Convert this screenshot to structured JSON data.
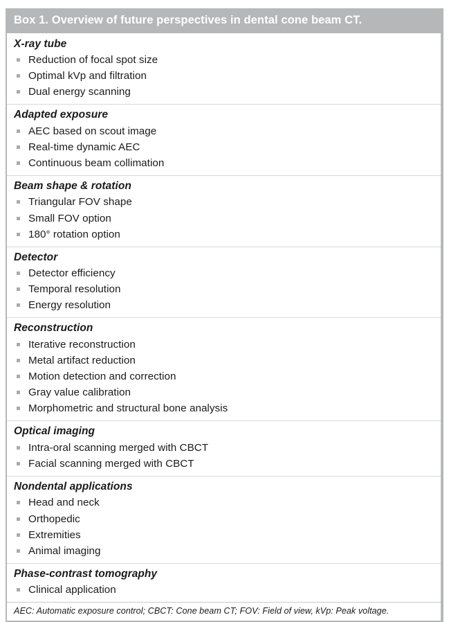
{
  "box": {
    "title": "Box 1. Overview of future perspectives in dental cone beam CT.",
    "header_background": "#b5b7b9",
    "header_text_color": "#ffffff",
    "border_color": "#b5b7b9",
    "bullet_color": "#a9abad",
    "bullet_icon": "square-bullet-icon",
    "sections": [
      {
        "title": "X-ray tube",
        "items": [
          "Reduction of focal spot size",
          "Optimal kVp and filtration",
          "Dual energy scanning"
        ]
      },
      {
        "title": "Adapted exposure",
        "items": [
          "AEC based on scout image",
          "Real-time dynamic AEC",
          "Continuous beam collimation"
        ]
      },
      {
        "title": "Beam shape & rotation",
        "items": [
          "Triangular FOV shape",
          "Small FOV option",
          "180° rotation option"
        ]
      },
      {
        "title": "Detector",
        "items": [
          "Detector efficiency",
          "Temporal resolution",
          "Energy resolution"
        ]
      },
      {
        "title": "Reconstruction",
        "items": [
          "Iterative reconstruction",
          "Metal artifact reduction",
          "Motion detection and correction",
          "Gray value calibration",
          "Morphometric and structural bone analysis"
        ]
      },
      {
        "title": "Optical imaging",
        "items": [
          "Intra-oral scanning merged with CBCT",
          "Facial scanning merged with CBCT"
        ]
      },
      {
        "title": "Nondental applications",
        "items": [
          "Head and neck",
          "Orthopedic",
          "Extremities",
          "Animal imaging"
        ]
      },
      {
        "title": "Phase-contrast tomography",
        "items": [
          "Clinical application"
        ]
      }
    ],
    "footnote": "AEC: Automatic exposure control; CBCT: Cone beam CT; FOV: Field of view, kVp: Peak voltage."
  }
}
